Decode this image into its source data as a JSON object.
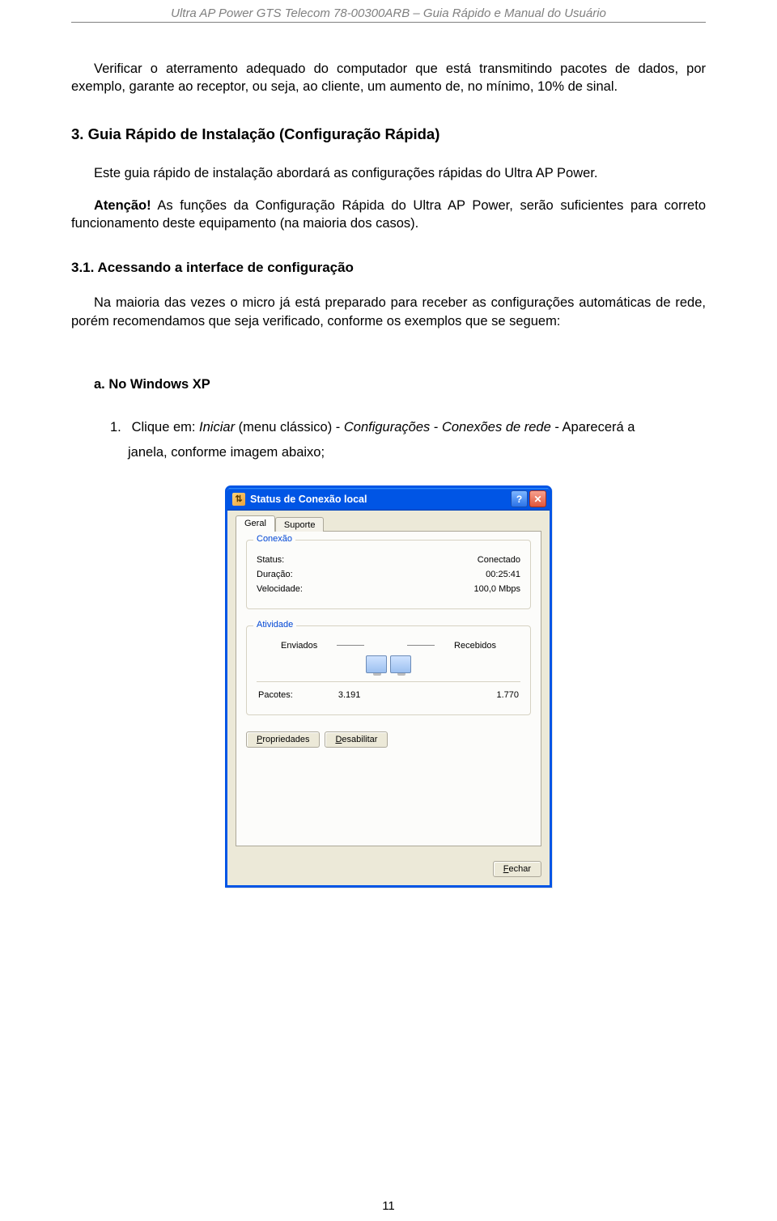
{
  "header": "Ultra AP Power GTS Telecom 78-00300ARB – Guia Rápido e Manual do Usuário",
  "para1": "Verificar o aterramento adequado do computador que está transmitindo pacotes de dados, por exemplo, garante ao receptor, ou seja, ao cliente, um aumento de, no mínimo, 10% de sinal.",
  "h3": "3. Guia Rápido de Instalação (Configuração Rápida)",
  "para2": "Este guia rápido de instalação abordará as configurações rápidas do Ultra AP Power.",
  "attention_label": "Atenção!",
  "attention_text": " As funções da Configuração Rápida do Ultra AP Power, serão suficientes para correto funcionamento deste equipamento (na maioria dos casos).",
  "h4": "3.1. Acessando a interface de configuração",
  "para3": "Na maioria das vezes o micro já está preparado para receber as configurações automáticas de rede, porém recomendamos que seja verificado, conforme os exemplos que se seguem:",
  "sub_a": "a. No Windows XP",
  "step_num": "1.",
  "step_pre": "Clique em: ",
  "step_i1": "Iniciar ",
  "step_mid1": "(menu clássico) - ",
  "step_i2": "Configurações",
  "step_mid2": " - ",
  "step_i3": "Conexões de rede",
  "step_mid3": " - Aparecerá a",
  "step_line2": "janela, conforme imagem abaixo;",
  "xp": {
    "title": "Status de Conexão local",
    "tab_general": "Geral",
    "tab_support": "Suporte",
    "grp_conn": "Conexão",
    "status_label": "Status:",
    "status_value": "Conectado",
    "duration_label": "Duração:",
    "duration_value": "00:25:41",
    "speed_label": "Velocidade:",
    "speed_value": "100,0 Mbps",
    "grp_act": "Atividade",
    "sent": "Enviados",
    "recv": "Recebidos",
    "packets_label": "Pacotes:",
    "packets_sent": "3.191",
    "packets_recv": "1.770",
    "btn_props": "Propriedades",
    "btn_disable": "Desabilitar",
    "btn_close": "Fechar"
  },
  "page_number": "11"
}
